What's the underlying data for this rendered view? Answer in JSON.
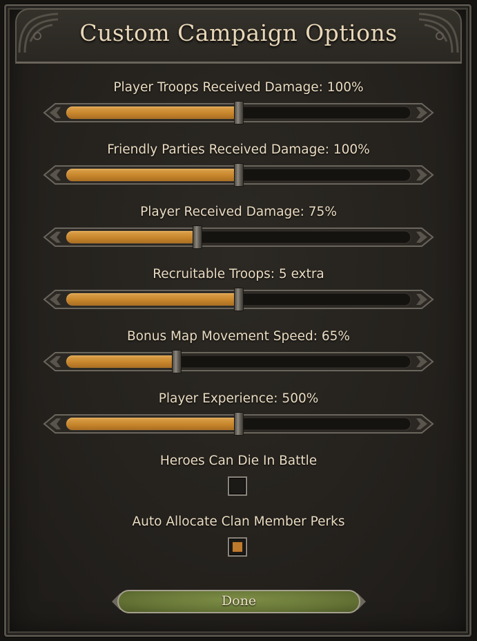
{
  "dialog": {
    "title": "Custom Campaign Options"
  },
  "sliders": [
    {
      "label": "Player Troops Received Damage: 100%",
      "value_fraction": 0.5
    },
    {
      "label": "Friendly Parties Received Damage: 100%",
      "value_fraction": 0.5
    },
    {
      "label": "Player Received Damage: 75%",
      "value_fraction": 0.38
    },
    {
      "label": "Recruitable Troops: 5 extra",
      "value_fraction": 0.5
    },
    {
      "label": "Bonus Map Movement Speed: 65%",
      "value_fraction": 0.32
    },
    {
      "label": "Player Experience: 500%",
      "value_fraction": 0.5
    }
  ],
  "checkboxes": [
    {
      "label": "Heroes Can Die In Battle",
      "checked": false
    },
    {
      "label": "Auto Allocate Clan Member Perks",
      "checked": true
    }
  ],
  "done_button": {
    "label": "Done"
  },
  "colors": {
    "fill": "#c7862c",
    "text": "#eadcc2",
    "button": "#667536",
    "check": "#c07a2c"
  }
}
